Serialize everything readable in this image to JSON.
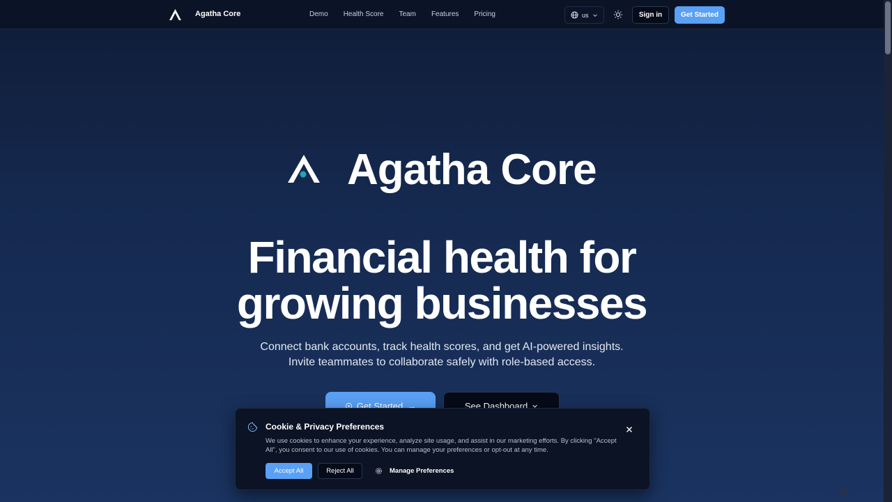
{
  "nav": {
    "brand": "Agatha Core",
    "links": [
      "Demo",
      "Health Score",
      "Team",
      "Features",
      "Pricing"
    ],
    "language": "us",
    "signin_label": "Sign in",
    "getstarted_label": "Get Started"
  },
  "hero": {
    "brand": "Agatha Core",
    "headline_line1": "Financial health for",
    "headline_line2": "growing businesses",
    "sub_line1": "Connect bank accounts, track health scores, and get AI-powered insights.",
    "sub_line2": "Invite teammates to collaborate safely with role-based access.",
    "cta_primary": "Get Started",
    "cta_secondary": "See Dashboard"
  },
  "cookie": {
    "title": "Cookie & Privacy Preferences",
    "body": "We use cookies to enhance your experience, analyze site usage, and assist in our marketing efforts. By clicking \"Accept All\", you consent to our use of cookies. You can manage your preferences or opt-out at any time.",
    "accept_label": "Accept All",
    "reject_label": "Reject All",
    "manage_label": "Manage Preferences"
  },
  "colors": {
    "accent": "#5aa0f4",
    "logo_dot": "#1fa5b8",
    "nav_bg": "#0b1426"
  },
  "icons": {
    "logo": "agatha-logo-icon",
    "language": "globe-icon",
    "theme": "sun-icon",
    "cookie": "cookie-icon",
    "close": "close-icon",
    "manage": "gear-icon"
  }
}
